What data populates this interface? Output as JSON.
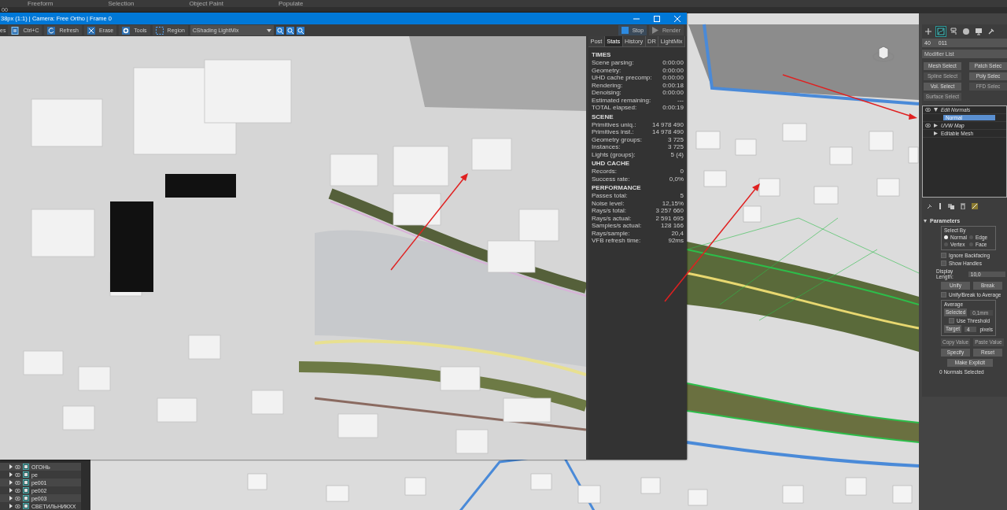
{
  "menu_bar": {
    "items": [
      "Freeform",
      "Selection",
      "Object Paint",
      "Populate"
    ]
  },
  "sub_bar": {
    "text": "00"
  },
  "vfb": {
    "title": "38px (1:1) | Camera: Free Ortho | Frame 0",
    "toolbar": {
      "cut_label": "es",
      "buttons": [
        "Ctrl+C",
        "Refresh",
        "Erase",
        "Tools",
        "Region"
      ],
      "channel_select": "CShading LightMix",
      "stop_button": "Stop",
      "render_button": {
        "label": "Render",
        "disabled": true
      }
    },
    "stats": {
      "tabs": [
        {
          "label": "Post",
          "selected": false
        },
        {
          "label": "Stats",
          "selected": true
        },
        {
          "label": "History",
          "selected": false
        },
        {
          "label": "DR",
          "selected": false
        },
        {
          "label": "LightMix",
          "selected": false
        }
      ],
      "sections": [
        {
          "title": "TIMES",
          "rows": [
            {
              "label": "Scene parsing:",
              "value": "0:00:00"
            },
            {
              "label": "Geometry:",
              "value": "0:00:00"
            },
            {
              "label": "UHD cache precomp:",
              "value": "0:00:00"
            },
            {
              "label": "Rendering:",
              "value": "0:00:18"
            },
            {
              "label": "Denoising:",
              "value": "0:00:00"
            },
            {
              "label": "Estimated remaining:",
              "value": "---"
            },
            {
              "label": "TOTAL elapsed:",
              "value": "0:00:19"
            }
          ]
        },
        {
          "title": "SCENE",
          "rows": [
            {
              "label": "Primitives uniq.:",
              "value": "14 978 490"
            },
            {
              "label": "Primitives inst.:",
              "value": "14 978 490"
            },
            {
              "label": "Geometry groups:",
              "value": "3 725"
            },
            {
              "label": "Instances:",
              "value": "3 725"
            },
            {
              "label": "Lights (groups):",
              "value": "5 (4)"
            }
          ]
        },
        {
          "title": "UHD CACHE",
          "rows": [
            {
              "label": "Records:",
              "value": "0"
            },
            {
              "label": "Success rate:",
              "value": "0,0%"
            }
          ]
        },
        {
          "title": "PERFORMANCE",
          "rows": [
            {
              "label": "Passes total:",
              "value": "5"
            },
            {
              "label": "Noise level:",
              "value": "12,15%"
            },
            {
              "label": "Rays/s total:",
              "value": "3 257 660"
            },
            {
              "label": "Rays/s actual:",
              "value": "2 591 695"
            },
            {
              "label": "Samples/s actual:",
              "value": "128 166"
            },
            {
              "label": "Rays/sample:",
              "value": "20,4"
            },
            {
              "label": "VFB refresh time:",
              "value": "92ms"
            }
          ]
        }
      ]
    }
  },
  "scene_explorer": {
    "rows": [
      {
        "label": "ОГОНЬ"
      },
      {
        "label": "pe"
      },
      {
        "label": "pe001"
      },
      {
        "label": "pe002"
      },
      {
        "label": "pe003"
      },
      {
        "label": "СВЕТИЛЬНИКХХ"
      }
    ]
  },
  "command_panel": {
    "tabs": [
      {
        "selected": false
      },
      {
        "selected": true
      },
      {
        "selected": false
      },
      {
        "selected": false
      },
      {
        "selected": false
      },
      {
        "selected": false
      }
    ],
    "name_field": {
      "prefix": "40",
      "value": "011"
    },
    "modifier_list": "Modifier List",
    "modifier_buttons": [
      {
        "label": "Mesh Select",
        "disabled": false
      },
      {
        "label": "Patch Selec",
        "disabled": false
      },
      {
        "label": "Spline Select",
        "disabled": true
      },
      {
        "label": "Poly Selec",
        "disabled": false
      },
      {
        "label": "Vol. Select",
        "disabled": false
      },
      {
        "label": "FFD Selec",
        "disabled": true
      },
      {
        "label": "Surface Select",
        "disabled": true
      }
    ],
    "stack": [
      {
        "label": "Edit Normals",
        "kind": "modifier",
        "expanded": true,
        "visible": true,
        "children": [
          {
            "label": "Normal",
            "selected": true
          }
        ]
      },
      {
        "label": "UVW Map",
        "kind": "modifier",
        "expanded": false,
        "visible": true
      },
      {
        "label": "Editable Mesh",
        "kind": "base",
        "expanded": false,
        "visible": false
      }
    ],
    "parameters": {
      "title": "Parameters",
      "expanded": true,
      "select_by": {
        "title": "Select By",
        "options": [
          {
            "label": "Normal",
            "selected": true
          },
          {
            "label": "Edge",
            "selected": false
          },
          {
            "label": "Vertex",
            "selected": false
          },
          {
            "label": "Face",
            "selected": false
          }
        ]
      },
      "checks": [
        {
          "label": "Ignore Backfacing",
          "checked": false
        },
        {
          "label": "Show Handles",
          "checked": false
        }
      ],
      "display_length": {
        "label": "Display Length:",
        "value": "10,0"
      },
      "unify_button": "Unify",
      "break_button": "Break",
      "unify_break_average": {
        "label": "Unify/Break to Average",
        "checked": false
      },
      "average": {
        "title": "Average",
        "selected_button": "Selected",
        "threshold_value": "0,1mm",
        "threshold_disabled": true,
        "use_threshold": {
          "label": "Use Threshold",
          "checked": false
        },
        "target_button": "Target",
        "target_value": "4",
        "target_unit": "pixels"
      },
      "value_buttons": [
        {
          "label": "Copy Value",
          "disabled": true
        },
        {
          "label": "Paste Value",
          "disabled": true
        }
      ],
      "specify_button": "Specify",
      "reset_button": "Reset",
      "make_explicit_button": "Make Explicit",
      "status": "0 Normals Selected"
    }
  }
}
